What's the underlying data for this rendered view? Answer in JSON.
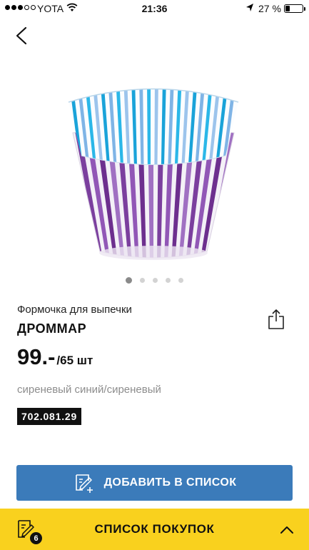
{
  "status_bar": {
    "carrier": "YOTA",
    "time": "21:36",
    "battery": "27 %",
    "battery_level": 0.27,
    "signal_bars": 3,
    "signal_total": 5
  },
  "product": {
    "subtitle": "Формочка для выпечки",
    "name": "ДРОММАР",
    "price": "99.-",
    "price_unit": "/65 шт",
    "color": "сиреневый синий/сиреневый",
    "article": "702.081.29",
    "image_count": 5,
    "active_image": 0
  },
  "actions": {
    "add_label": "ДОБАВИТЬ В СПИСОК"
  },
  "bottom_bar": {
    "label": "СПИСОК ПОКУПОК",
    "badge": "6"
  },
  "colors": {
    "accent": "#3b7bba",
    "bottom_bar": "#f9d11e"
  }
}
